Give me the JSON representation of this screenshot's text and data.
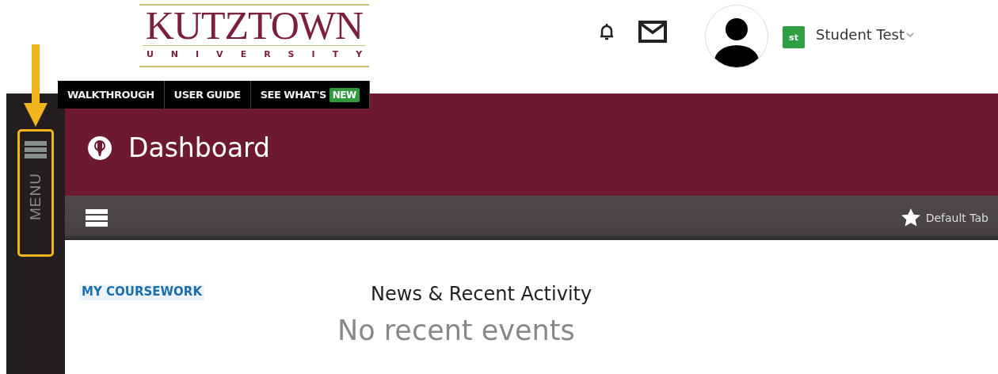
{
  "logo": {
    "name": "KUTZTOWN",
    "subtitle": "UNIVERSITY"
  },
  "user": {
    "initials": "st",
    "name": "Student Test"
  },
  "top_links": [
    {
      "label": "WALKTHROUGH"
    },
    {
      "label": "USER GUIDE"
    },
    {
      "label": "SEE WHAT'S",
      "badge": "NEW"
    }
  ],
  "sidebar": {
    "label": "MENU",
    "highlighted": true
  },
  "page": {
    "title": "Dashboard"
  },
  "toolbar": {
    "default_tab": "Default Tab"
  },
  "coursework": {
    "heading": "MY COURSEWORK"
  },
  "news": {
    "heading": "News & Recent Activity",
    "empty": "No recent events"
  }
}
